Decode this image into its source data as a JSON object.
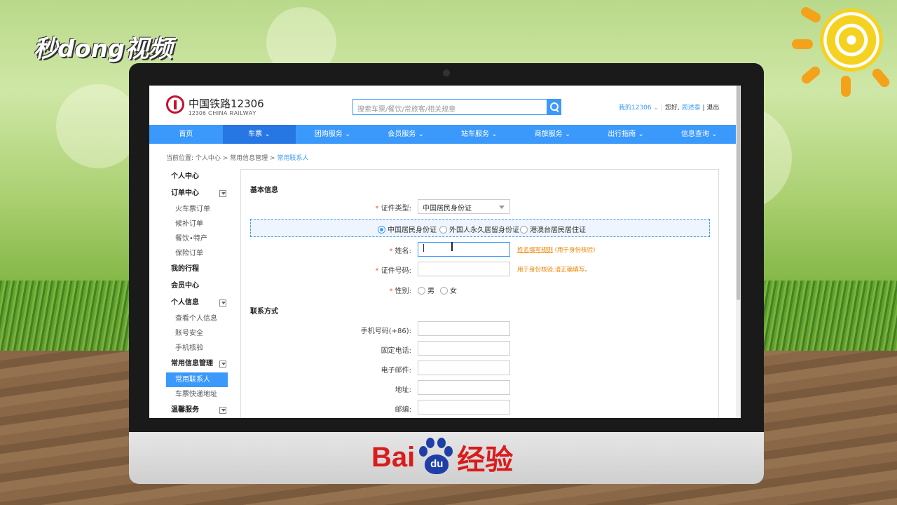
{
  "watermark": {
    "top_logo": "秒dong视频",
    "bottom_logo_text": "Bai",
    "bottom_logo_paw": "du",
    "bottom_logo_suffix": "经验"
  },
  "site": {
    "brand_cn": "中国铁路12306",
    "brand_en": "12306 CHINA RAILWAY",
    "search_placeholder": "搜索车票/餐饮/常旅客/相关规章",
    "my_account": "我的12306",
    "greeting": "您好,",
    "username": "周述泰",
    "logout": "退出"
  },
  "nav": [
    "首页",
    "车票",
    "团购服务",
    "会员服务",
    "站车服务",
    "商旅服务",
    "出行指南",
    "信息查询"
  ],
  "nav_active_index": 1,
  "breadcrumb": {
    "prefix": "当前位置:",
    "path": "个人中心 > 常用信息管理 > ",
    "current": "常用联系人"
  },
  "sidebar": [
    {
      "type": "head",
      "label": "个人中心"
    },
    {
      "type": "head",
      "label": "订单中心",
      "toggle": true
    },
    {
      "type": "item",
      "label": "火车票订单"
    },
    {
      "type": "item",
      "label": "候补订单"
    },
    {
      "type": "item",
      "label": "餐饮•特产"
    },
    {
      "type": "item",
      "label": "保险订单"
    },
    {
      "type": "head",
      "label": "我的行程"
    },
    {
      "type": "head",
      "label": "会员中心"
    },
    {
      "type": "head",
      "label": "个人信息",
      "toggle": true
    },
    {
      "type": "item",
      "label": "查看个人信息"
    },
    {
      "type": "item",
      "label": "账号安全"
    },
    {
      "type": "item",
      "label": "手机核验"
    },
    {
      "type": "head",
      "label": "常用信息管理",
      "toggle": true
    },
    {
      "type": "item",
      "label": "常用联系人",
      "active": true
    },
    {
      "type": "item",
      "label": "车票快递地址"
    },
    {
      "type": "head",
      "label": "温馨服务",
      "toggle": true
    }
  ],
  "form": {
    "basic_title": "基本信息",
    "id_type_label": "证件类型:",
    "id_type_value": "中国居民身份证",
    "id_options": [
      "中国居民身份证",
      "外国人永久居留身份证",
      "港澳台居民居住证"
    ],
    "id_option_selected": 0,
    "name_label": "姓名:",
    "name_value": "",
    "name_hint_link": "姓名填写规则",
    "name_hint": "(用于身份核验)",
    "idno_label": "证件号码:",
    "idno_value": "",
    "idno_hint": "用于身份核验,请正确填写。",
    "gender_label": "性别:",
    "gender_options": [
      "男",
      "女"
    ],
    "contact_title": "联系方式",
    "mobile_label": "手机号码(+86):",
    "phone_label": "固定电话:",
    "email_label": "电子邮件:",
    "address_label": "地址:",
    "zip_label": "邮编:"
  }
}
